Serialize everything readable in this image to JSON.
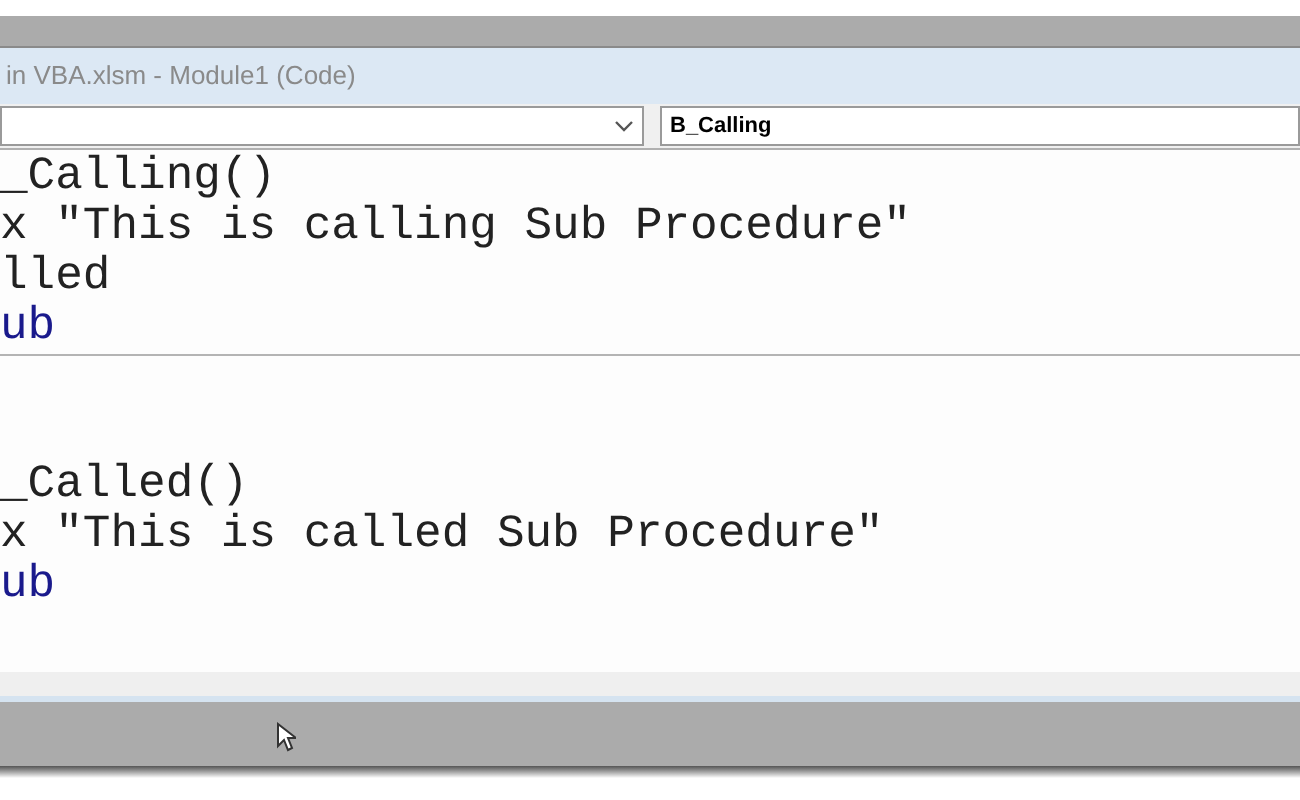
{
  "window": {
    "title": "in VBA.xlsm - Module1 (Code)"
  },
  "procedure_dropdown": {
    "value": "B_Calling"
  },
  "procedures": [
    {
      "lines": [
        {
          "kind": "plain",
          "text": "_Calling()"
        },
        {
          "kind": "plain",
          "text": "x \"This is calling Sub Procedure\""
        },
        {
          "kind": "plain",
          "text": "lled"
        },
        {
          "kind": "keyword",
          "text": "ub"
        }
      ]
    },
    {
      "lines": [
        {
          "kind": "plain",
          "text": "_Called()"
        },
        {
          "kind": "plain",
          "text": "x \"This is called Sub Procedure\""
        },
        {
          "kind": "keyword",
          "text": "ub"
        }
      ]
    }
  ]
}
